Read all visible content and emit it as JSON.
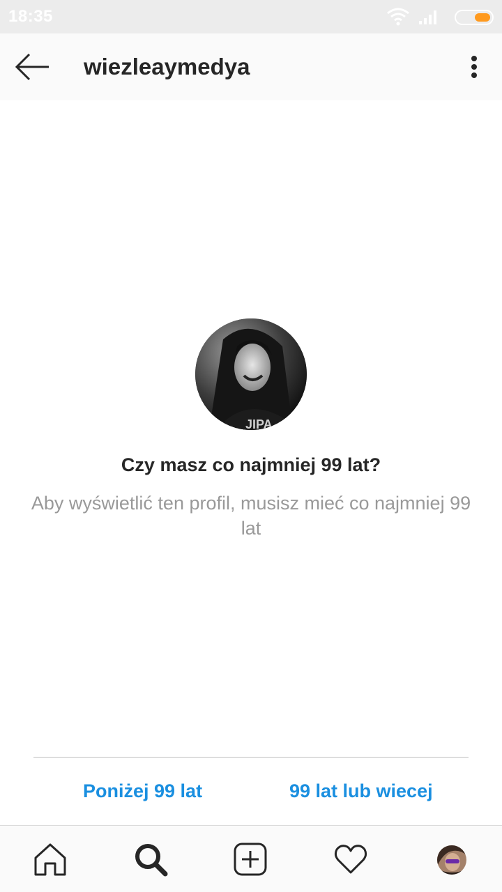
{
  "status_bar": {
    "time": "18:35"
  },
  "header": {
    "back_icon": "arrow-left-icon",
    "username": "wiezleaymedya",
    "more_icon": "more-vertical-icon"
  },
  "age_gate": {
    "question": "Czy masz co najmniej 99 lat?",
    "explanation": "Aby wyświetlić ten profil, musisz mieć co najmniej 99 lat",
    "option_below": "Poniżej 99 lat",
    "option_above": "99 lat lub wiecej"
  },
  "bottom_nav": {
    "items": [
      {
        "icon": "home-icon"
      },
      {
        "icon": "search-icon"
      },
      {
        "icon": "add-post-icon"
      },
      {
        "icon": "heart-icon"
      },
      {
        "icon": "profile-avatar"
      }
    ]
  },
  "colors": {
    "link_blue": "#1a8fe0",
    "text_dark": "#262626",
    "text_muted": "#999999",
    "battery": "#ff9a1f"
  }
}
